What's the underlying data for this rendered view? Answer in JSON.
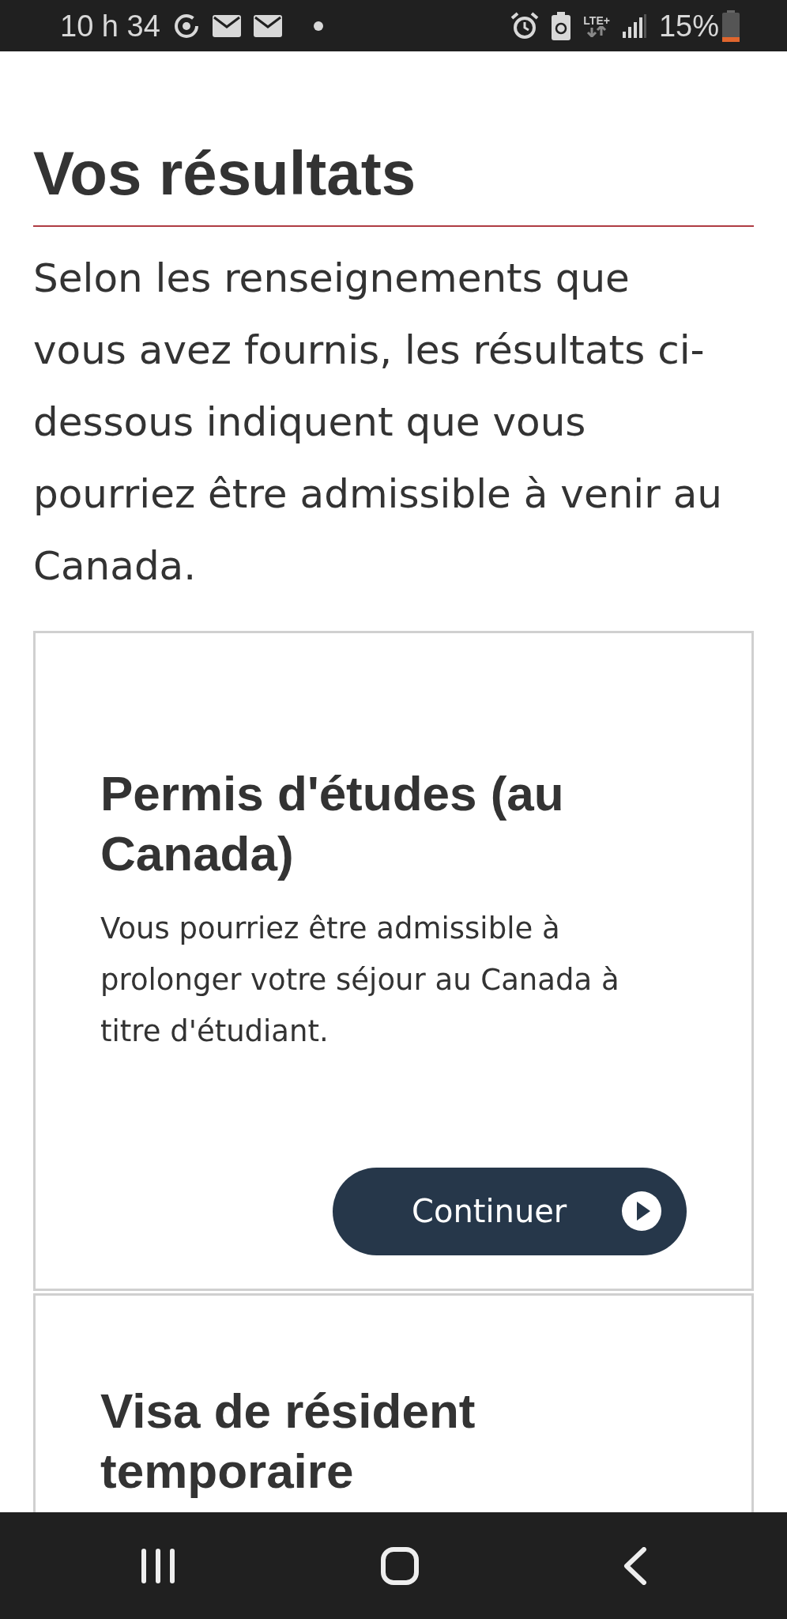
{
  "status_bar": {
    "time": "10 h 34",
    "network": "LTE+",
    "battery": "15%"
  },
  "heading": "Vos résultats",
  "intro": "Selon les renseignements que vous avez fournis, les résultats ci-dessous indiquent que vous pourriez être admissible à venir au Canada.",
  "results": [
    {
      "title": "Permis d'études (au Canada)",
      "description": "Vous pourriez être admissible à prolonger votre séjour au Canada à titre d'étudiant.",
      "button": "Continuer"
    },
    {
      "title": "Visa de résident temporaire"
    }
  ]
}
